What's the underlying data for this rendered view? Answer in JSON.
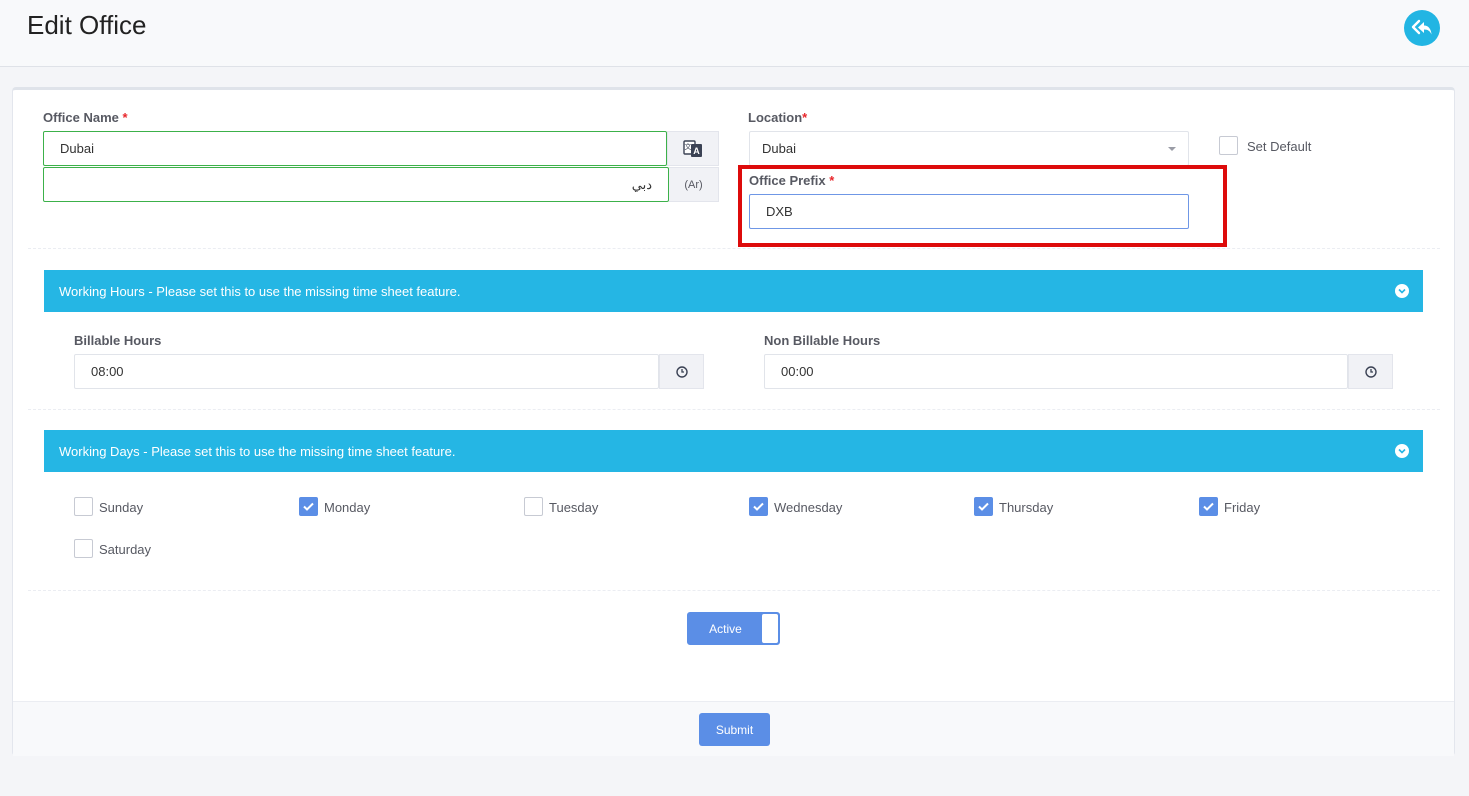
{
  "header": {
    "title": "Edit Office",
    "back_icon": "reply-all-icon"
  },
  "office_name": {
    "label": "Office Name",
    "value": "Dubai",
    "value_ar": "دبي",
    "translate_icon": "translate-icon",
    "ar_addon": "(Ar)"
  },
  "location": {
    "label": "Location",
    "value": "Dubai"
  },
  "set_default": {
    "label": "Set Default",
    "checked": false
  },
  "office_prefix": {
    "label": "Office Prefix",
    "value": "DXB"
  },
  "required_mark": "*",
  "working_hours": {
    "banner": "Working Hours - Please set this to use the missing time sheet feature.",
    "billable": {
      "label": "Billable Hours",
      "value": "08:00"
    },
    "non_billable": {
      "label": "Non Billable Hours",
      "value": "00:00"
    }
  },
  "working_days": {
    "banner": "Working Days - Please set this to use the missing time sheet feature.",
    "days": [
      {
        "label": "Sunday",
        "checked": false
      },
      {
        "label": "Monday",
        "checked": true
      },
      {
        "label": "Tuesday",
        "checked": false
      },
      {
        "label": "Wednesday",
        "checked": true
      },
      {
        "label": "Thursday",
        "checked": true
      },
      {
        "label": "Friday",
        "checked": true
      },
      {
        "label": "Saturday",
        "checked": false
      }
    ]
  },
  "status_toggle": {
    "label": "Active",
    "on": true
  },
  "footer": {
    "submit_label": "Submit"
  },
  "colors": {
    "accent": "#25b6e4",
    "primary": "#5b8ee6",
    "required": "#e8262b",
    "highlight": "#dd0b0b"
  }
}
